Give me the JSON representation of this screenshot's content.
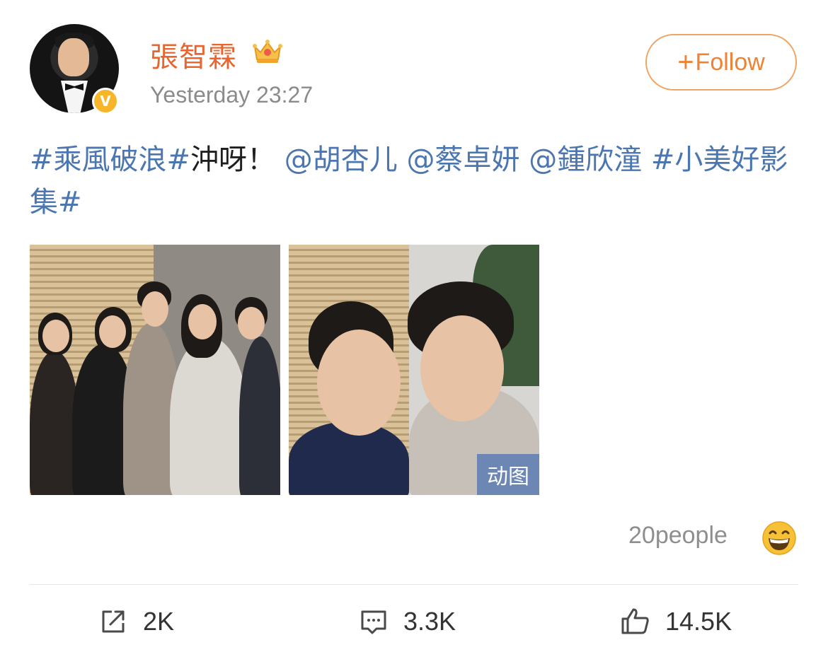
{
  "header": {
    "username": "張智霖",
    "timestamp": "Yesterday 23:27",
    "follow_plus": "+",
    "follow_label": "Follow",
    "verified_mark": "V"
  },
  "post": {
    "segments": [
      {
        "text": "#乘風破浪#",
        "type": "hashtag"
      },
      {
        "text": "沖呀！",
        "type": "plain"
      },
      {
        "text": "@胡杏儿",
        "type": "mention"
      },
      {
        "text": " ",
        "type": "plain"
      },
      {
        "text": "@蔡卓妍",
        "type": "mention"
      },
      {
        "text": " ",
        "type": "plain"
      },
      {
        "text": "@鍾欣潼",
        "type": "mention"
      },
      {
        "text": " ",
        "type": "plain"
      },
      {
        "text": "#小美好影集#",
        "type": "hashtag"
      }
    ],
    "gif_tag": "动图"
  },
  "likers": {
    "text": "20people"
  },
  "actions": {
    "repost_count": "2K",
    "comment_count": "3.3K",
    "like_count": "14.5K"
  },
  "colors": {
    "username": "#e8652f",
    "link": "#4b76b0",
    "follow_border": "#f0a461",
    "verified_badge": "#f7b52a",
    "gif_tag_bg": "#6c87b3"
  }
}
